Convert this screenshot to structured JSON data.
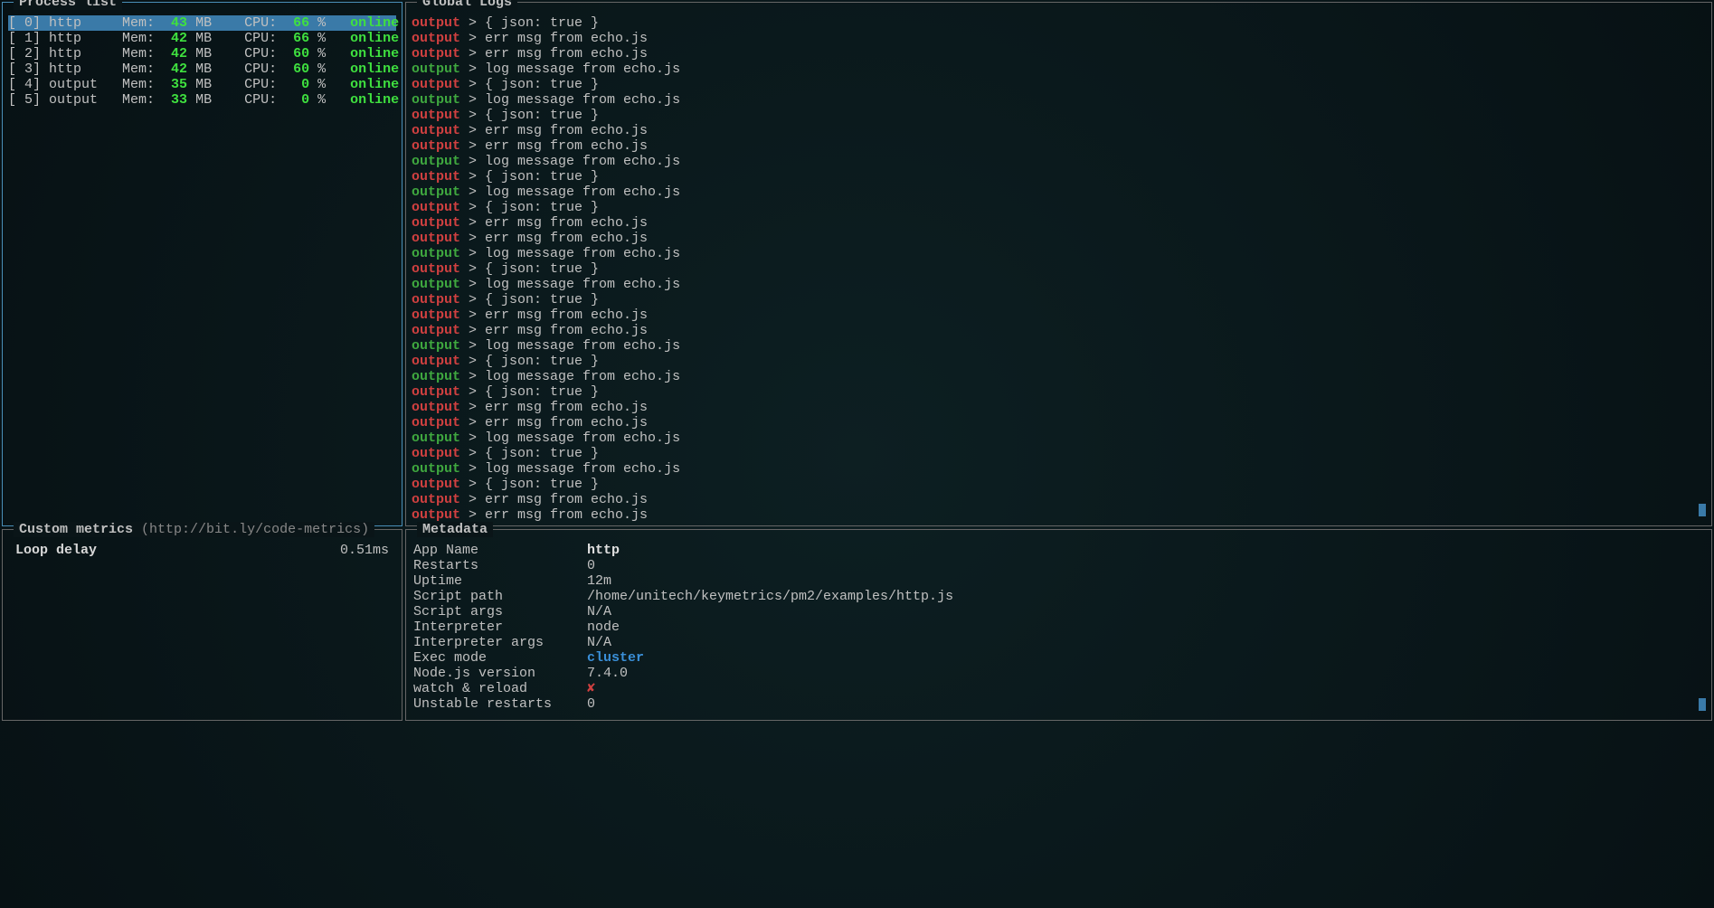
{
  "panels": {
    "process_list": {
      "title": "Process list"
    },
    "global_logs": {
      "title": "Global Logs"
    },
    "custom_metrics": {
      "title": "Custom metrics",
      "hint": "(http://bit.ly/code-metrics)"
    },
    "metadata": {
      "title": "Metadata"
    }
  },
  "process_list": [
    {
      "idx": "[ 0]",
      "name": "http",
      "mem_label": "Mem:",
      "mem": "43",
      "mem_unit": "MB",
      "cpu_label": "CPU:",
      "cpu": "66",
      "pct": "%",
      "status": "online",
      "selected": true
    },
    {
      "idx": "[ 1]",
      "name": "http",
      "mem_label": "Mem:",
      "mem": "42",
      "mem_unit": "MB",
      "cpu_label": "CPU:",
      "cpu": "66",
      "pct": "%",
      "status": "online",
      "selected": false
    },
    {
      "idx": "[ 2]",
      "name": "http",
      "mem_label": "Mem:",
      "mem": "42",
      "mem_unit": "MB",
      "cpu_label": "CPU:",
      "cpu": "60",
      "pct": "%",
      "status": "online",
      "selected": false
    },
    {
      "idx": "[ 3]",
      "name": "http",
      "mem_label": "Mem:",
      "mem": "42",
      "mem_unit": "MB",
      "cpu_label": "CPU:",
      "cpu": "60",
      "pct": "%",
      "status": "online",
      "selected": false
    },
    {
      "idx": "[ 4]",
      "name": "output",
      "mem_label": "Mem:",
      "mem": "35",
      "mem_unit": "MB",
      "cpu_label": "CPU:",
      "cpu": "0",
      "pct": "%",
      "status": "online",
      "selected": false
    },
    {
      "idx": "[ 5]",
      "name": "output",
      "mem_label": "Mem:",
      "mem": "33",
      "mem_unit": "MB",
      "cpu_label": "CPU:",
      "cpu": "0",
      "pct": "%",
      "status": "online",
      "selected": false
    }
  ],
  "logs": [
    {
      "src": "output",
      "type": "err",
      "msg": "{ json: true }"
    },
    {
      "src": "output",
      "type": "err",
      "msg": "err msg from echo.js"
    },
    {
      "src": "output",
      "type": "err",
      "msg": "err msg from echo.js"
    },
    {
      "src": "output",
      "type": "out",
      "msg": "log message from echo.js"
    },
    {
      "src": "output",
      "type": "err",
      "msg": "{ json: true }"
    },
    {
      "src": "output",
      "type": "out",
      "msg": "log message from echo.js"
    },
    {
      "src": "output",
      "type": "err",
      "msg": "{ json: true }"
    },
    {
      "src": "output",
      "type": "err",
      "msg": "err msg from echo.js"
    },
    {
      "src": "output",
      "type": "err",
      "msg": "err msg from echo.js"
    },
    {
      "src": "output",
      "type": "out",
      "msg": "log message from echo.js"
    },
    {
      "src": "output",
      "type": "err",
      "msg": "{ json: true }"
    },
    {
      "src": "output",
      "type": "out",
      "msg": "log message from echo.js"
    },
    {
      "src": "output",
      "type": "err",
      "msg": "{ json: true }"
    },
    {
      "src": "output",
      "type": "err",
      "msg": "err msg from echo.js"
    },
    {
      "src": "output",
      "type": "err",
      "msg": "err msg from echo.js"
    },
    {
      "src": "output",
      "type": "out",
      "msg": "log message from echo.js"
    },
    {
      "src": "output",
      "type": "err",
      "msg": "{ json: true }"
    },
    {
      "src": "output",
      "type": "out",
      "msg": "log message from echo.js"
    },
    {
      "src": "output",
      "type": "err",
      "msg": "{ json: true }"
    },
    {
      "src": "output",
      "type": "err",
      "msg": "err msg from echo.js"
    },
    {
      "src": "output",
      "type": "err",
      "msg": "err msg from echo.js"
    },
    {
      "src": "output",
      "type": "out",
      "msg": "log message from echo.js"
    },
    {
      "src": "output",
      "type": "err",
      "msg": "{ json: true }"
    },
    {
      "src": "output",
      "type": "out",
      "msg": "log message from echo.js"
    },
    {
      "src": "output",
      "type": "err",
      "msg": "{ json: true }"
    },
    {
      "src": "output",
      "type": "err",
      "msg": "err msg from echo.js"
    },
    {
      "src": "output",
      "type": "err",
      "msg": "err msg from echo.js"
    },
    {
      "src": "output",
      "type": "out",
      "msg": "log message from echo.js"
    },
    {
      "src": "output",
      "type": "err",
      "msg": "{ json: true }"
    },
    {
      "src": "output",
      "type": "out",
      "msg": "log message from echo.js"
    },
    {
      "src": "output",
      "type": "err",
      "msg": "{ json: true }"
    },
    {
      "src": "output",
      "type": "err",
      "msg": "err msg from echo.js"
    },
    {
      "src": "output",
      "type": "err",
      "msg": "err msg from echo.js"
    }
  ],
  "custom_metrics": [
    {
      "label": "Loop delay",
      "value": "0.51ms"
    }
  ],
  "metadata": [
    {
      "key": "App Name",
      "val": "http",
      "style": "bold"
    },
    {
      "key": "Restarts",
      "val": "0",
      "style": ""
    },
    {
      "key": "Uptime",
      "val": "12m",
      "style": ""
    },
    {
      "key": "Script path",
      "val": "/home/unitech/keymetrics/pm2/examples/http.js",
      "style": ""
    },
    {
      "key": "Script args",
      "val": "N/A",
      "style": ""
    },
    {
      "key": "Interpreter",
      "val": "node",
      "style": ""
    },
    {
      "key": "Interpreter args",
      "val": "N/A",
      "style": ""
    },
    {
      "key": "Exec mode",
      "val": "cluster",
      "style": "blue"
    },
    {
      "key": "Node.js version",
      "val": "7.4.0",
      "style": ""
    },
    {
      "key": "watch & reload",
      "val": "✘",
      "style": "red"
    },
    {
      "key": "Unstable restarts",
      "val": "0",
      "style": ""
    }
  ]
}
